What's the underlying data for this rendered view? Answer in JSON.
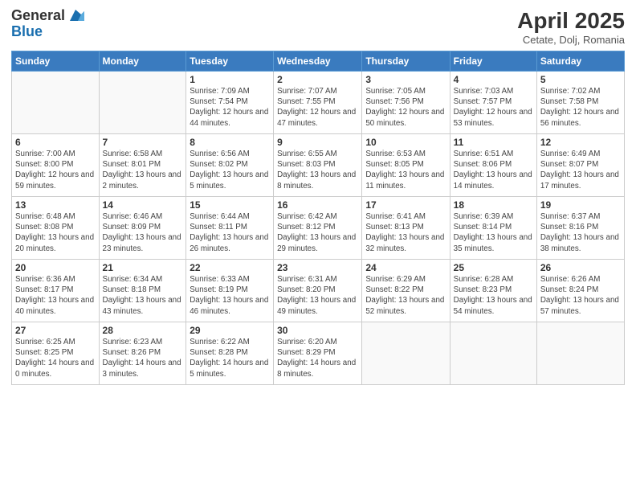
{
  "header": {
    "logo_general": "General",
    "logo_blue": "Blue",
    "month_title": "April 2025",
    "subtitle": "Cetate, Dolj, Romania"
  },
  "weekdays": [
    "Sunday",
    "Monday",
    "Tuesday",
    "Wednesday",
    "Thursday",
    "Friday",
    "Saturday"
  ],
  "weeks": [
    [
      {
        "day": "",
        "info": ""
      },
      {
        "day": "",
        "info": ""
      },
      {
        "day": "1",
        "info": "Sunrise: 7:09 AM\nSunset: 7:54 PM\nDaylight: 12 hours and 44 minutes."
      },
      {
        "day": "2",
        "info": "Sunrise: 7:07 AM\nSunset: 7:55 PM\nDaylight: 12 hours and 47 minutes."
      },
      {
        "day": "3",
        "info": "Sunrise: 7:05 AM\nSunset: 7:56 PM\nDaylight: 12 hours and 50 minutes."
      },
      {
        "day": "4",
        "info": "Sunrise: 7:03 AM\nSunset: 7:57 PM\nDaylight: 12 hours and 53 minutes."
      },
      {
        "day": "5",
        "info": "Sunrise: 7:02 AM\nSunset: 7:58 PM\nDaylight: 12 hours and 56 minutes."
      }
    ],
    [
      {
        "day": "6",
        "info": "Sunrise: 7:00 AM\nSunset: 8:00 PM\nDaylight: 12 hours and 59 minutes."
      },
      {
        "day": "7",
        "info": "Sunrise: 6:58 AM\nSunset: 8:01 PM\nDaylight: 13 hours and 2 minutes."
      },
      {
        "day": "8",
        "info": "Sunrise: 6:56 AM\nSunset: 8:02 PM\nDaylight: 13 hours and 5 minutes."
      },
      {
        "day": "9",
        "info": "Sunrise: 6:55 AM\nSunset: 8:03 PM\nDaylight: 13 hours and 8 minutes."
      },
      {
        "day": "10",
        "info": "Sunrise: 6:53 AM\nSunset: 8:05 PM\nDaylight: 13 hours and 11 minutes."
      },
      {
        "day": "11",
        "info": "Sunrise: 6:51 AM\nSunset: 8:06 PM\nDaylight: 13 hours and 14 minutes."
      },
      {
        "day": "12",
        "info": "Sunrise: 6:49 AM\nSunset: 8:07 PM\nDaylight: 13 hours and 17 minutes."
      }
    ],
    [
      {
        "day": "13",
        "info": "Sunrise: 6:48 AM\nSunset: 8:08 PM\nDaylight: 13 hours and 20 minutes."
      },
      {
        "day": "14",
        "info": "Sunrise: 6:46 AM\nSunset: 8:09 PM\nDaylight: 13 hours and 23 minutes."
      },
      {
        "day": "15",
        "info": "Sunrise: 6:44 AM\nSunset: 8:11 PM\nDaylight: 13 hours and 26 minutes."
      },
      {
        "day": "16",
        "info": "Sunrise: 6:42 AM\nSunset: 8:12 PM\nDaylight: 13 hours and 29 minutes."
      },
      {
        "day": "17",
        "info": "Sunrise: 6:41 AM\nSunset: 8:13 PM\nDaylight: 13 hours and 32 minutes."
      },
      {
        "day": "18",
        "info": "Sunrise: 6:39 AM\nSunset: 8:14 PM\nDaylight: 13 hours and 35 minutes."
      },
      {
        "day": "19",
        "info": "Sunrise: 6:37 AM\nSunset: 8:16 PM\nDaylight: 13 hours and 38 minutes."
      }
    ],
    [
      {
        "day": "20",
        "info": "Sunrise: 6:36 AM\nSunset: 8:17 PM\nDaylight: 13 hours and 40 minutes."
      },
      {
        "day": "21",
        "info": "Sunrise: 6:34 AM\nSunset: 8:18 PM\nDaylight: 13 hours and 43 minutes."
      },
      {
        "day": "22",
        "info": "Sunrise: 6:33 AM\nSunset: 8:19 PM\nDaylight: 13 hours and 46 minutes."
      },
      {
        "day": "23",
        "info": "Sunrise: 6:31 AM\nSunset: 8:20 PM\nDaylight: 13 hours and 49 minutes."
      },
      {
        "day": "24",
        "info": "Sunrise: 6:29 AM\nSunset: 8:22 PM\nDaylight: 13 hours and 52 minutes."
      },
      {
        "day": "25",
        "info": "Sunrise: 6:28 AM\nSunset: 8:23 PM\nDaylight: 13 hours and 54 minutes."
      },
      {
        "day": "26",
        "info": "Sunrise: 6:26 AM\nSunset: 8:24 PM\nDaylight: 13 hours and 57 minutes."
      }
    ],
    [
      {
        "day": "27",
        "info": "Sunrise: 6:25 AM\nSunset: 8:25 PM\nDaylight: 14 hours and 0 minutes."
      },
      {
        "day": "28",
        "info": "Sunrise: 6:23 AM\nSunset: 8:26 PM\nDaylight: 14 hours and 3 minutes."
      },
      {
        "day": "29",
        "info": "Sunrise: 6:22 AM\nSunset: 8:28 PM\nDaylight: 14 hours and 5 minutes."
      },
      {
        "day": "30",
        "info": "Sunrise: 6:20 AM\nSunset: 8:29 PM\nDaylight: 14 hours and 8 minutes."
      },
      {
        "day": "",
        "info": ""
      },
      {
        "day": "",
        "info": ""
      },
      {
        "day": "",
        "info": ""
      }
    ]
  ]
}
